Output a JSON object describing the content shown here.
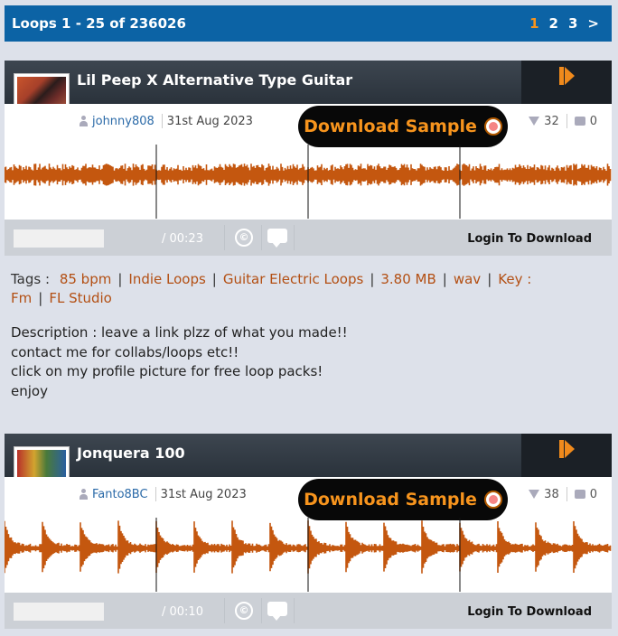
{
  "pager": {
    "summary": "Loops 1 - 25 of 236026",
    "pages": [
      "1",
      "2",
      "3",
      ">"
    ],
    "active_page": "1"
  },
  "loops": [
    {
      "title": "Lil Peep X Alternative Type Guitar",
      "user": "johnny808",
      "date": "31st Aug 2023",
      "download_label": "Download Sample",
      "downvotes": "32",
      "comments": "0",
      "time": "/ 00:23",
      "cc_label": "©",
      "login_label": "Login To Download",
      "tags_label": "Tags :",
      "tags": [
        "85 bpm",
        "Indie Loops",
        "Guitar Electric Loops",
        "3.80 MB",
        "wav",
        "Key : Fm",
        "FL Studio"
      ],
      "description": "Description : leave a link plzz of what you made!!\ncontact me for collabs/loops etc!!\nclick on my profile picture for free loop packs!\nenjoy",
      "waveform_style": "dense"
    },
    {
      "title": "Jonquera 100",
      "user": "Fanto8BC",
      "date": "31st Aug 2023",
      "download_label": "Download Sample",
      "downvotes": "38",
      "comments": "0",
      "time": "/ 00:10",
      "cc_label": "©",
      "login_label": "Login To Download",
      "waveform_style": "transient"
    }
  ],
  "colors": {
    "pager_bg": "#0c63a5",
    "accent": "#f7941d",
    "waveform": "#c4570f",
    "tag_link": "#b34f13"
  },
  "icons": [
    "person-icon",
    "drum-icon",
    "thumbs-down-icon",
    "comment-icon",
    "play-icon",
    "creative-commons-icon",
    "comment-bubble-icon"
  ]
}
